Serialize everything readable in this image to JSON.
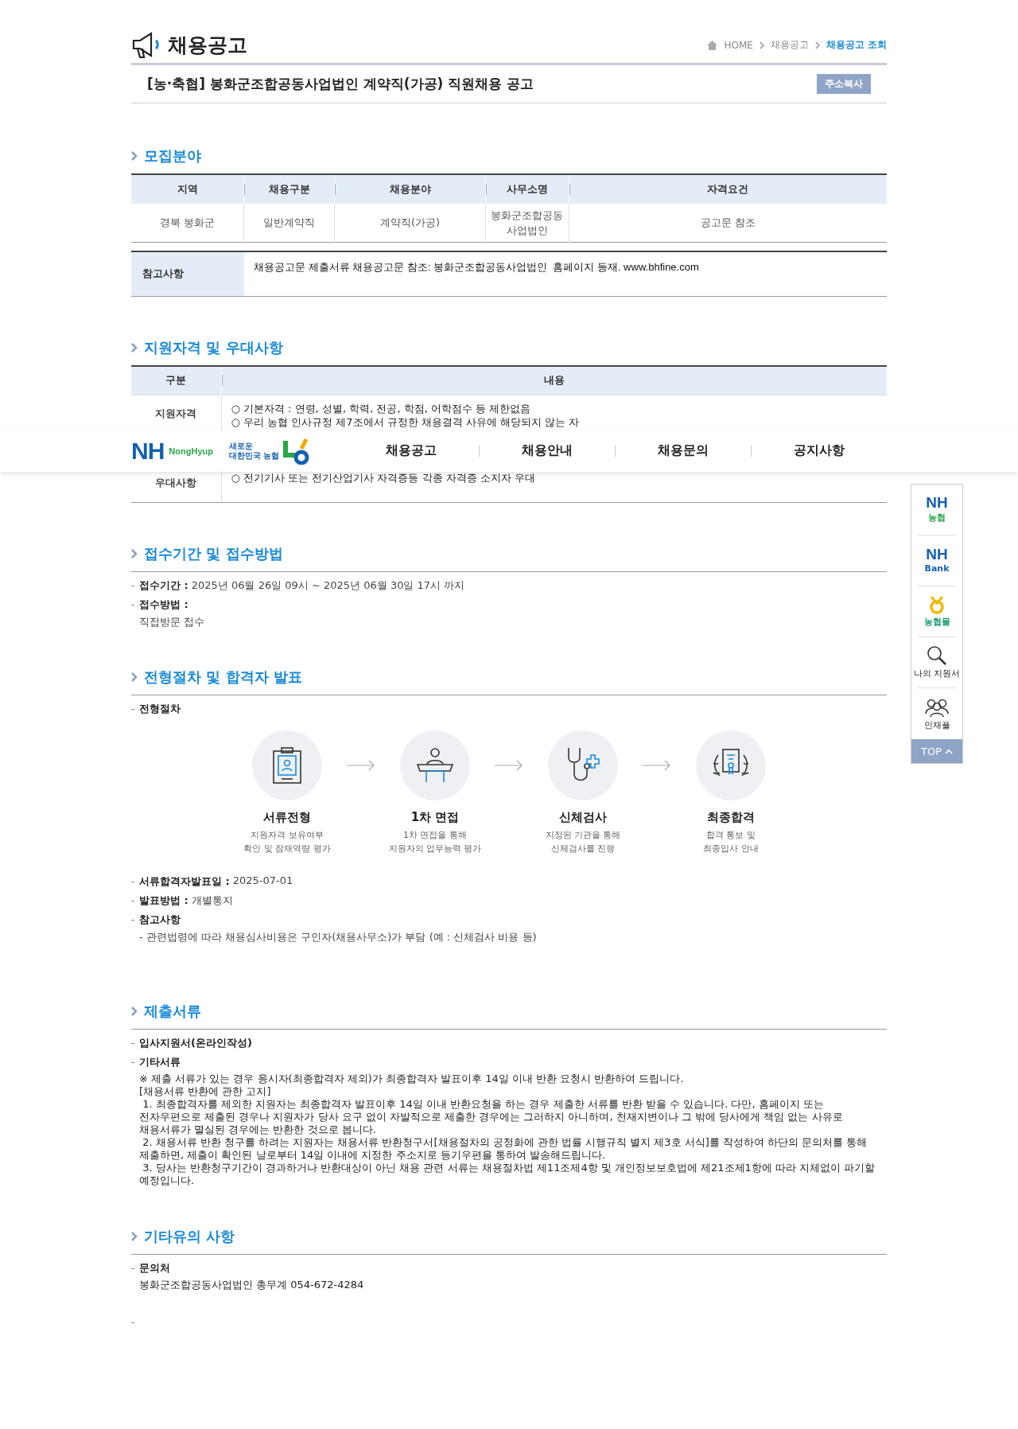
{
  "page_header": {
    "title": "채용공고",
    "breadcrumb": [
      {
        "label": "HOME",
        "selected": false
      },
      {
        "label": "채용공고",
        "selected": false
      },
      {
        "label": "채용공고 조회",
        "selected": true
      }
    ]
  },
  "notice": {
    "title": "[농·축협] 봉화군조합공동사업법인 계약직(가공) 직원채용 공고",
    "copy_button": "주소복사"
  },
  "recruitment": {
    "heading": "모집분야",
    "columns": [
      "지역",
      "채용구분",
      "채용분야",
      "사무소명",
      "자격요건"
    ],
    "rows": [
      [
        "경북 봉화군",
        "일반계약직",
        "계약직(가공)",
        "봉화군조합공동사업법인",
        "공고문 참조"
      ]
    ],
    "note": {
      "label": "참고사항",
      "text": "채용공고문 제출서류 채용공고문 참조: 봉화군조합공동사업법인  홈페이지 등재. www.bhfine.com"
    }
  },
  "qualifications": {
    "heading": "지원자격 및 우대사항",
    "columns": [
      "구분",
      "내용"
    ],
    "rows": [
      {
        "label": "지원자격",
        "lines": [
          "○ 기본자격 : 연령, 성별, 학력, 전공, 학점, 어학점수 등 제한없음",
          "○ 우리 농협 인사규정 제7조에서 규정한 채용결격 사유에 해당되지 않는 자"
        ]
      },
      {
        "label": "우대사항",
        "lines": [
          "○ 전기기사 또는 전기산업기사 자격증등 각종 자격증 소지자  우대"
        ]
      }
    ]
  },
  "nav": {
    "logo": "NH",
    "logo_sub": "NongHyup",
    "slogan_top": "새로운",
    "slogan_bottom": "대한민국 농협",
    "menu": [
      "채용공고",
      "채용안내",
      "채용문의",
      "공지사항"
    ]
  },
  "application": {
    "heading": "접수기간 및 접수방법",
    "items": [
      {
        "kind": "inline",
        "label": "접수기간 :",
        "value": "2025년 06월 26일 09시 ~ 2025년 06월 30일 17시 까지"
      },
      {
        "kind": "block",
        "label": "접수방법 :",
        "value": "직접방문 접수"
      }
    ]
  },
  "process": {
    "heading": "전형절차 및 합격자 발표",
    "steps_label": "전형절차",
    "steps": [
      {
        "kind": "documents",
        "title": "서류전형",
        "lines": [
          "지원자격 보유여부",
          "확인 및 잠재역량 평가"
        ]
      },
      {
        "kind": "interview",
        "title": "1차 면접",
        "lines": [
          "1차 면접을 통해",
          "지원자의 업무능력 평가"
        ]
      },
      {
        "kind": "medical",
        "title": "신체검사",
        "lines": [
          "지정된 기관을 통해",
          "신체검사를 진행"
        ]
      },
      {
        "kind": "final",
        "title": "최종합격",
        "lines": [
          "합격 통보 및",
          "최종입사 안내"
        ]
      }
    ],
    "items": [
      {
        "kind": "inline",
        "label": "서류합격자발표일 :",
        "value": "2025-07-01"
      },
      {
        "kind": "inline",
        "label": "발표방법 :",
        "value": "개별통지"
      },
      {
        "kind": "block",
        "label": "참고사항",
        "value": "- 관련법령에 따라 채용심사비용은 구인자(채용사무소)가 부담 (예 : 신체검사 비용 등)"
      }
    ]
  },
  "documents": {
    "heading": "제출서류",
    "items": [
      {
        "label": "입사지원서(온라인작성)"
      },
      {
        "label": "기타서류",
        "lines": [
          "※ 제출 서류가 있는 경우 응시자(최종합격자 제외)가 최종합격자 발표이후 14일 이내 반환 요청시 반환하여 드립니다.",
          "[채용서류 반환에 관한 고지]",
          " 1. 최종합격자를 제외한 지원자는 최종합격자 발표이후 14일 이내 반환요청을 하는 경우 제출한 서류를 반환 받을 수 있습니다. 다만, 홈페이지 또는",
          "전자우편으로 제출된 경우나 지원자가 당사 요구 없이 자발적으로 제출한 경우에는 그러하지 아니하며, 천재지변이나 그 밖에 당사에게 책임 없는 사유로",
          "채용서류가 멸실된 경우에는 반환한 것으로 봅니다.",
          " 2. 채용서류 반환 청구를 하려는 지원자는 채용서류 반환청구서[채용절차의 공정화에 관한 법률 시행규칙 별지 제3호 서식]를 작성하여 하단의 문의처를 통해",
          "제출하면, 제출이 확인된 날로부터 14일 이내에 지정한 주소지로 등기우편을 통하여 발송해드립니다.",
          " 3. 당사는 반환청구기간이 경과하거나 반환대상이 아닌 채용 관련 서류는 채용절차법 제11조제4항 및 개인정보보호법에 제21조제1항에 따라 지체없이 파기할",
          "예정입니다."
        ]
      }
    ]
  },
  "other": {
    "heading": "기타유의 사항",
    "items": [
      {
        "label": "문의처",
        "lines": [
          "봉화군조합공동사업법인 총무계 054-672-4284"
        ]
      }
    ],
    "empty_bullet": true
  },
  "quick_menu": {
    "items": [
      {
        "kind": "brand",
        "title": "NH",
        "caption": "농협",
        "color": "#2aa44a"
      },
      {
        "kind": "brand",
        "title": "NH",
        "caption": "Bank",
        "color": "#1560b0"
      },
      {
        "kind": "mall",
        "caption": "농협몰",
        "color": "#1a9a6a"
      },
      {
        "kind": "search",
        "caption": "나의 지원서"
      },
      {
        "kind": "people",
        "caption": "인재풀"
      }
    ],
    "top_button": "TOP"
  }
}
